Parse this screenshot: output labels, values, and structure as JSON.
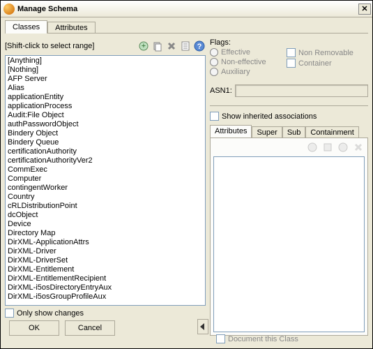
{
  "window": {
    "title": "Manage Schema"
  },
  "mainTabs": {
    "classes": "Classes",
    "attributes": "Attributes"
  },
  "left": {
    "hint": "[Shift-click to select range]",
    "onlyShowChanges": "Only show changes",
    "items": [
      "[Anything]",
      "[Nothing]",
      "AFP Server",
      "Alias",
      "applicationEntity",
      "applicationProcess",
      "Audit:File Object",
      "authPasswordObject",
      "Bindery Object",
      "Bindery Queue",
      "certificationAuthority",
      "certificationAuthorityVer2",
      "CommExec",
      "Computer",
      "contingentWorker",
      "Country",
      "cRLDistributionPoint",
      "dcObject",
      "Device",
      "Directory Map",
      "DirXML-ApplicationAttrs",
      "DirXML-Driver",
      "DirXML-DriverSet",
      "DirXML-Entitlement",
      "DirXML-EntitlementRecipient",
      "DirXML-i5osDirectoryEntryAux",
      "DirXML-i5osGroupProfileAux"
    ]
  },
  "buttons": {
    "ok": "OK",
    "cancel": "Cancel"
  },
  "right": {
    "flagsLabel": "Flags:",
    "effective": "Effective",
    "nonEffective": "Non-effective",
    "auxiliary": "Auxiliary",
    "nonRemovable": "Non Removable",
    "container": "Container",
    "asn1": "ASN1:",
    "showInherited": "Show inherited associations",
    "subtabs": {
      "attributes": "Attributes",
      "super": "Super",
      "sub": "Sub",
      "containment": "Containment"
    },
    "documentClass": "Document this Class"
  }
}
